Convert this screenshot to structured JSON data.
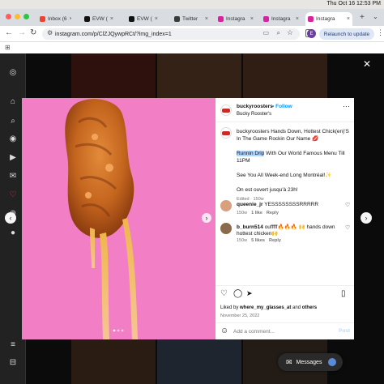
{
  "menubar": {
    "datetime": "Thu Oct 16  12:53 PM"
  },
  "tabs": [
    {
      "label": "Inbox (6",
      "icon": "gmail-icon",
      "color": "#ea4335"
    },
    {
      "label": "EVW (",
      "icon": "x-icon",
      "color": "#111111"
    },
    {
      "label": "EVW (",
      "icon": "x-icon",
      "color": "#111111"
    },
    {
      "label": "Twitter",
      "icon": "twitter-icon",
      "color": "#222222"
    },
    {
      "label": "Instagra",
      "icon": "instagram-icon",
      "color": "#d6249f"
    },
    {
      "label": "Instagra",
      "icon": "instagram-icon",
      "color": "#d6249f"
    },
    {
      "label": "Instagra",
      "icon": "instagram-icon",
      "color": "#d6249f"
    }
  ],
  "toolbar": {
    "url": "instagram.com/p/ClZJQywpRCt/?img_index=1",
    "profile_initial": "E",
    "relaunch_label": "Relaunch to update"
  },
  "post": {
    "username": "buckyroosters",
    "follow_label": "Follow",
    "subtitle": "Bucky Rooster's",
    "caption_line1": "buckyroosters Hands Down, Hottest Chick(en)'S In The Game Rockin Our Name 💋",
    "caption_highlight": "Runnin Drip",
    "caption_line2": " With Our World Famous Menu Till 11PM",
    "caption_line3": "See You All Week-end Long Montréal!✨",
    "caption_line4": "On est ouvert jusqu'à 23h!",
    "caption_meta": "Edited · 150w",
    "comments": [
      {
        "user": "queenie_jr",
        "text": "YESSSSSSSSRRRRR",
        "age": "150w",
        "likes": "1 like",
        "reply": "Reply"
      },
      {
        "user": "b_burn514",
        "text": "oufffff🔥🔥🔥 🙌 hands down hottest chicken🙌",
        "age": "150w",
        "likes": "5 likes",
        "reply": "Reply"
      }
    ],
    "liked_by_prefix": "Liked by ",
    "liked_by_user": "where_my_glasses_at",
    "liked_by_suffix": " and ",
    "liked_by_others": "others",
    "date": "November 25, 2022",
    "add_comment_placeholder": "Add a comment...",
    "post_label": "Post"
  },
  "messages_label": "Messages",
  "colors": {
    "accent": "#0095f6",
    "photo_bg": "#f27fc6"
  }
}
